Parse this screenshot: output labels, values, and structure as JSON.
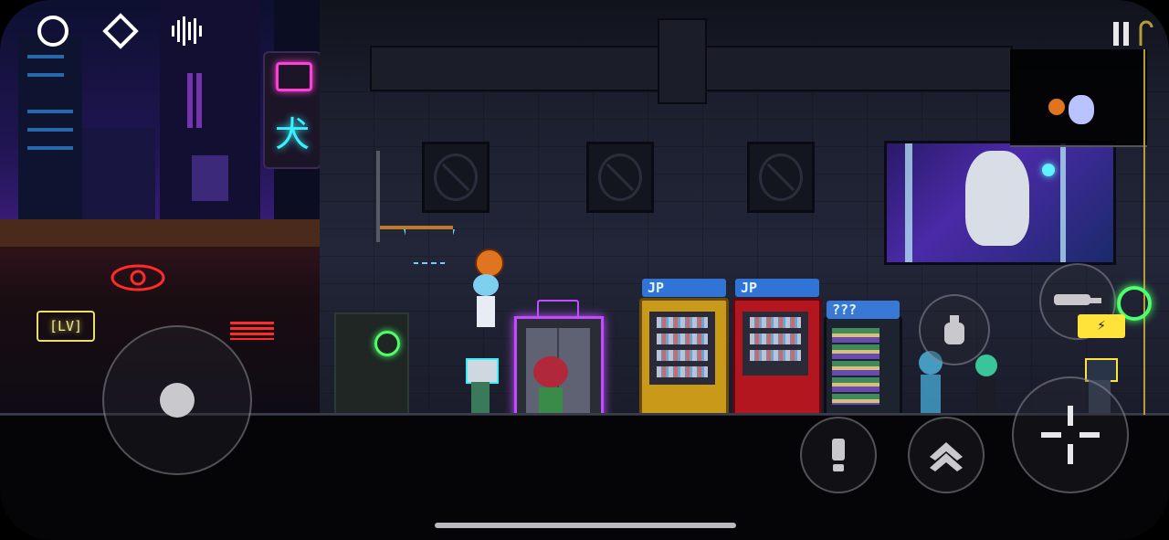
{
  "hud": {
    "top_left_icons": [
      "circle-icon",
      "diamond-icon",
      "sound-wave-icon"
    ],
    "top_right_icons": [
      "pause-icon",
      "scroll-ornament-icon"
    ]
  },
  "scene": {
    "neon_sign_kanji": "犬",
    "vending_labels": [
      "JP",
      "JP",
      "???"
    ],
    "building_sign": "[LV]"
  },
  "controls": {
    "joystick": "virtual-joystick",
    "buttons": [
      "interact-button",
      "jump-button",
      "attack-button",
      "dash-button",
      "grenade-button",
      "special-skill-button",
      "weapon-swap-button"
    ]
  },
  "colors": {
    "neon_pink": "#ff3fd6",
    "neon_cyan": "#39f0ff",
    "neon_red": "#ff2a2a",
    "neon_green": "#4dff6a",
    "neon_yellow": "#ffe23a"
  }
}
